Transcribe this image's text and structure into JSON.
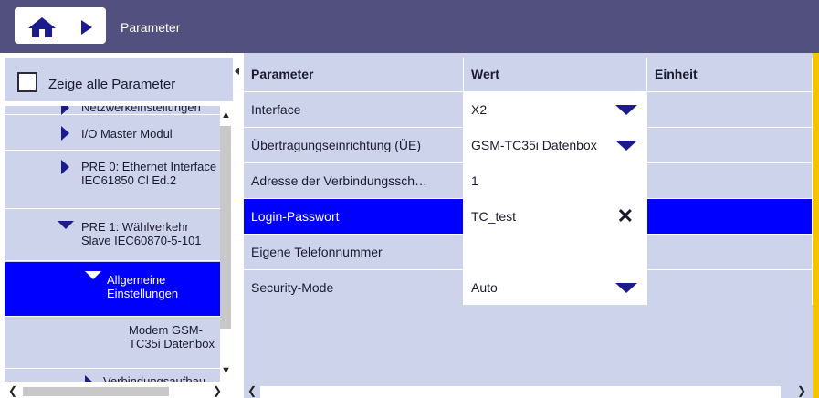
{
  "topbar": {
    "title": "Parameter",
    "home_icon": "home-icon",
    "nav_icon": "play-circle-icon"
  },
  "left_panel": {
    "show_all_label": "Zeige alle Parameter",
    "show_all_checked": false,
    "tree": [
      {
        "label": "Netzwerkeinstellungen",
        "expanded": false,
        "selected": false
      },
      {
        "label": "I/O Master Modul",
        "expanded": false,
        "selected": false
      },
      {
        "label": "PRE 0: Ethernet Interface IEC61850 Cl Ed.2",
        "expanded": false,
        "selected": false
      },
      {
        "label": "PRE 1: Wählverkehr Slave IEC60870-5-101",
        "expanded": true,
        "selected": false
      },
      {
        "label": "Allgemeine Einstellungen",
        "expanded": true,
        "selected": true
      },
      {
        "label": "Modem GSM-TC35i Datenbox",
        "expanded": false,
        "selected": false
      },
      {
        "label": "Verbindungsaufbau",
        "expanded": false,
        "selected": false
      }
    ]
  },
  "table": {
    "headers": {
      "param": "Parameter",
      "value": "Wert",
      "unit": "Einheit"
    },
    "rows": [
      {
        "param": "Interface",
        "value": "X2",
        "unit": "",
        "control": "dropdown"
      },
      {
        "param": "Übertragungseinrichtung (ÜE)",
        "value": "GSM-TC35i Datenbox",
        "unit": "",
        "control": "dropdown"
      },
      {
        "param": "Adresse der Verbindungssch…",
        "value": "1",
        "unit": "",
        "control": "text"
      },
      {
        "param": "Login-Passwort",
        "value": "TC_test",
        "unit": "",
        "control": "clearable",
        "active": true
      },
      {
        "param": "Eigene Telefonnummer",
        "value": "",
        "unit": "",
        "control": "text"
      },
      {
        "param": "Security-Mode",
        "value": "Auto",
        "unit": "",
        "control": "dropdown"
      }
    ]
  },
  "colors": {
    "topbar": "#51507e",
    "panel": "#ced3ec",
    "selected": "#0000ff",
    "accent": "#f4c400",
    "icon": "#1b1b8e"
  }
}
